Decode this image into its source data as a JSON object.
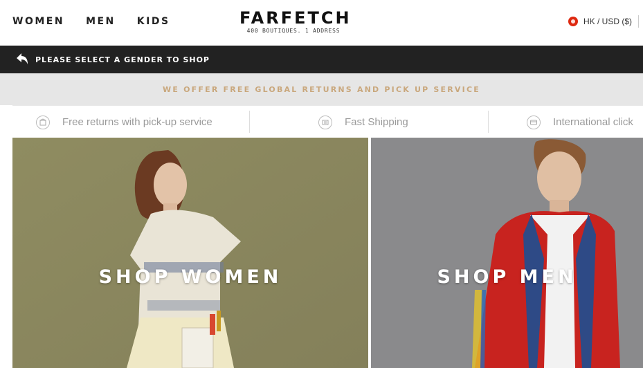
{
  "nav": {
    "items": [
      "WOMEN",
      "MEN",
      "KIDS"
    ]
  },
  "logo": {
    "wordmark": "FARFETCH",
    "tagline": "400 BOUTIQUES. 1 ADDRESS"
  },
  "region": {
    "label": "HK / USD ($)",
    "flag": "hong-kong-flag"
  },
  "gender_bar": {
    "text": "PLEASE SELECT A GENDER TO SHOP"
  },
  "promo": {
    "text": "WE OFFER FREE GLOBAL RETURNS AND PICK UP SERVICE",
    "color": "#c9a77c"
  },
  "services": [
    {
      "label": "Free returns with pick-up service",
      "icon": "box-icon"
    },
    {
      "label": "Fast Shipping",
      "icon": "delivery-icon"
    },
    {
      "label": "International click",
      "icon": "card-icon"
    }
  ],
  "hero": {
    "women_label": "SHOP WOMEN",
    "men_label": "SHOP MEN"
  },
  "colors": {
    "gender_bar_bg": "#222222",
    "promo_bg": "#e6e6e6",
    "women_bg": "#8e8a5f",
    "men_bg": "#8b8b8d"
  }
}
